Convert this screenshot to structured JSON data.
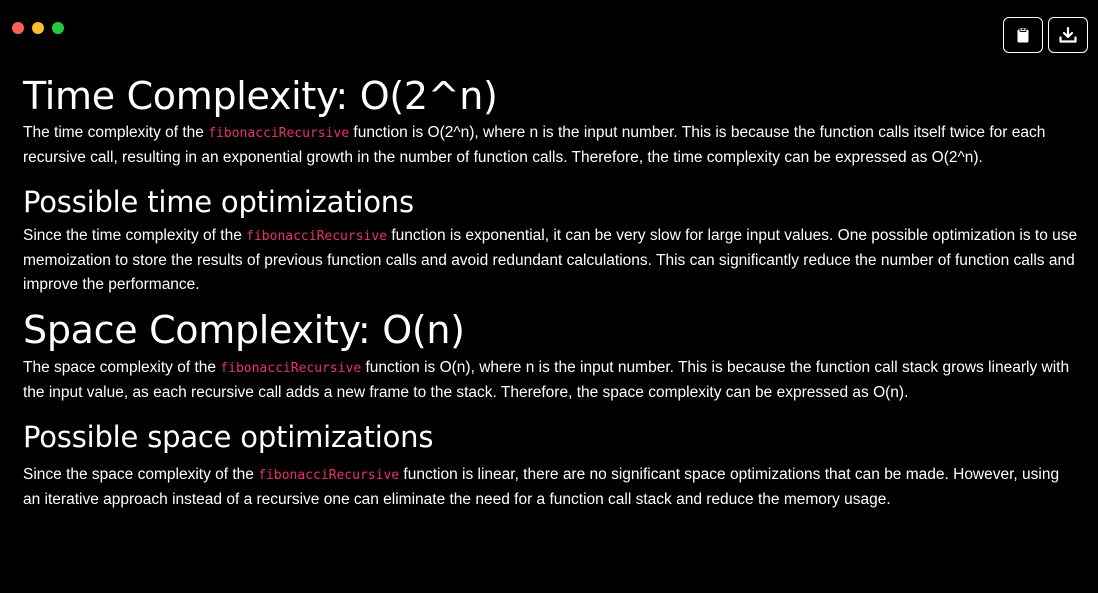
{
  "window": {
    "controls": [
      {
        "name": "close",
        "color": "#ff5f57"
      },
      {
        "name": "minimize",
        "color": "#febc2e"
      },
      {
        "name": "maximize",
        "color": "#28c840"
      }
    ]
  },
  "toolbar": {
    "copy_icon": "clipboard-icon",
    "download_icon": "download-icon"
  },
  "colors": {
    "background": "#000000",
    "text": "#ffffff",
    "code": "#e8336d"
  },
  "sections": [
    {
      "heading": "Time Complexity: O(2^n)",
      "before": "The time complexity of the ",
      "code": "fibonacciRecursive",
      "after": " function is O(2^n), where n is the input number. This is because the function calls itself twice for each recursive call, resulting in an exponential growth in the number of function calls. Therefore, the time complexity can be expressed as O(2^n)."
    },
    {
      "heading": "Possible time optimizations",
      "before": "Since the time complexity of the ",
      "code": "fibonacciRecursive",
      "after": " function is exponential, it can be very slow for large input values. One possible optimization is to use memoization to store the results of previous function calls and avoid redundant calculations. This can significantly reduce the number of function calls and improve the performance."
    },
    {
      "heading": "Space Complexity: O(n)",
      "before": "The space complexity of the ",
      "code": "fibonacciRecursive",
      "after": " function is O(n), where n is the input number. This is because the function call stack grows linearly with the input value, as each recursive call adds a new frame to the stack. Therefore, the space complexity can be expressed as O(n)."
    },
    {
      "heading": "Possible space optimizations",
      "before": "Since the space complexity of the ",
      "code": "fibonacciRecursive",
      "after": " function is linear, there are no significant space optimizations that can be made. However, using an iterative approach instead of a recursive one can eliminate the need for a function call stack and reduce the memory usage."
    }
  ]
}
